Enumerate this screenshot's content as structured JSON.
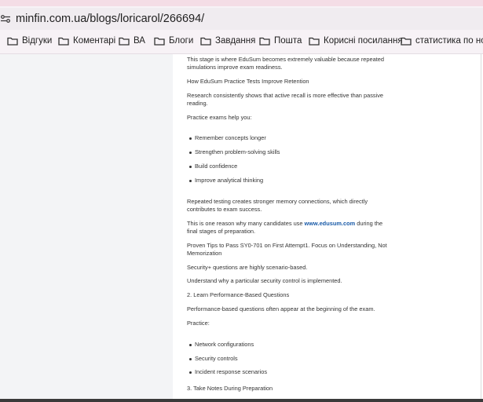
{
  "browser": {
    "url": "minfin.com.ua/blogs/loricarol/266694/",
    "bookmarks": [
      {
        "label": "Відгуки"
      },
      {
        "label": "Коментарі"
      },
      {
        "label": "ВА"
      },
      {
        "label": "Блоги"
      },
      {
        "label": "Завдання"
      },
      {
        "label": "Пошта"
      },
      {
        "label": "Корисні посилання"
      },
      {
        "label": "статистика по нов..."
      }
    ]
  },
  "article": {
    "p1": "This stage is where EduSum becomes extremely valuable because repeated simulations improve exam readiness.",
    "h1": "How EduSum Practice Tests Improve Retention",
    "p2": "Research consistently shows that active recall is more effective than passive reading.",
    "p3": "Practice exams help you:",
    "list1": [
      "Remember concepts longer",
      "Strengthen problem-solving skills",
      "Build confidence",
      "Improve analytical thinking"
    ],
    "p4": "Repeated testing creates stronger memory connections, which directly contributes to exam success.",
    "p5_before": "This is one reason why many candidates use ",
    "p5_link": "www.edusum.com",
    "p5_after": " during the final stages of preparation.",
    "p6": "Proven Tips to Pass SY0-701 on First Attempt1. Focus on Understanding, Not Memorization",
    "p7": "Security+ questions are highly scenario-based.",
    "p8": "Understand why a particular security control is implemented.",
    "p9": "2. Learn Performance-Based Questions",
    "p10": "Performance-based questions often appear at the beginning of the exam.",
    "p11": "Practice:",
    "list2": [
      "Network configurations",
      "Security controls",
      "Incident response scenarios"
    ],
    "p12": "3. Take Notes During Preparation"
  },
  "colors": {
    "link": "#1a5ba8",
    "sidebar": "#f3f4f6",
    "chrome": "#f7f2f6"
  }
}
